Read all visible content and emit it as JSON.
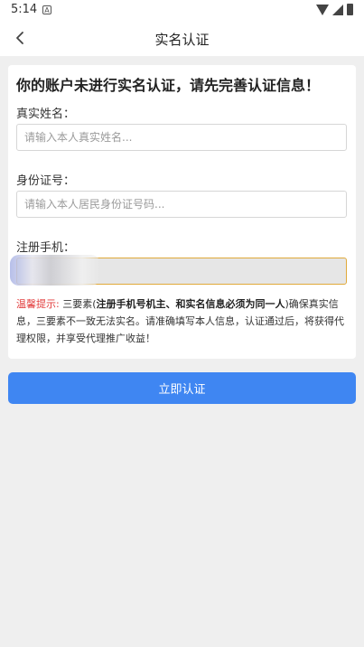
{
  "status_bar": {
    "time": "5:14",
    "notification_icon": "A"
  },
  "nav": {
    "title": "实名认证",
    "back_icon": "chevron-left-icon"
  },
  "form": {
    "heading": "你的账户未进行实名认证，请先完善认证信息！",
    "name": {
      "label": "真实姓名：",
      "placeholder": "请输入本人真实姓名..."
    },
    "id_number": {
      "label": "身份证号：",
      "placeholder": "请输入本人居民身份证号码..."
    },
    "phone": {
      "label": "注册手机：",
      "value": ""
    },
    "tip": {
      "label": "温馨提示:",
      "text_before": " 三要素(",
      "bold": "注册手机号机主、和实名信息必须为同一人",
      "text_after": ")确保真实信息，三要素不一致无法实名。请准确填写本人信息，认证通过后，将获得代理权限，并享受代理推广收益！"
    }
  },
  "submit": {
    "label": "立即认证"
  },
  "colors": {
    "accent": "#3f86f2",
    "tip_label": "#e23b3b",
    "phone_border": "#e0a93a"
  }
}
